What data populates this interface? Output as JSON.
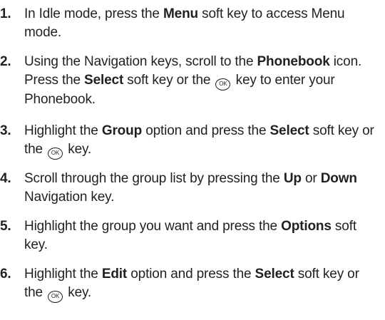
{
  "steps": [
    {
      "number": "1.",
      "parts": [
        {
          "t": "In Idle mode, press the "
        },
        {
          "t": "Menu",
          "b": true
        },
        {
          "t": " soft key to access Menu mode."
        }
      ]
    },
    {
      "number": "2.",
      "parts": [
        {
          "t": "Using the Navigation keys, scroll to the "
        },
        {
          "t": "Phonebook",
          "b": true
        },
        {
          "t": " icon. Press the "
        },
        {
          "t": "Select",
          "b": true
        },
        {
          "t": " soft key or the "
        },
        {
          "icon": "ok-key-icon",
          "glyph": "OK"
        },
        {
          "t": " key to enter your Phonebook."
        }
      ]
    },
    {
      "number": "3.",
      "parts": [
        {
          "t": "Highlight the "
        },
        {
          "t": "Group",
          "b": true
        },
        {
          "t": " option and press the "
        },
        {
          "t": "Select",
          "b": true
        },
        {
          "t": " soft key or the "
        },
        {
          "icon": "ok-key-icon",
          "glyph": "OK"
        },
        {
          "t": " key."
        }
      ]
    },
    {
      "number": "4.",
      "parts": [
        {
          "t": "Scroll through the group list by pressing the "
        },
        {
          "t": "Up",
          "b": true
        },
        {
          "t": " or "
        },
        {
          "t": "Down",
          "b": true
        },
        {
          "t": " Navigation key."
        }
      ]
    },
    {
      "number": "5.",
      "parts": [
        {
          "t": "Highlight the group you want and press the "
        },
        {
          "t": "Options",
          "b": true
        },
        {
          "t": " soft key."
        }
      ]
    },
    {
      "number": "6.",
      "parts": [
        {
          "t": "Highlight the "
        },
        {
          "t": "Edit",
          "b": true
        },
        {
          "t": " option and press the "
        },
        {
          "t": "Select",
          "b": true
        },
        {
          "t": " soft key or the "
        },
        {
          "icon": "ok-key-icon",
          "glyph": "OK"
        },
        {
          "t": " key."
        }
      ]
    }
  ]
}
